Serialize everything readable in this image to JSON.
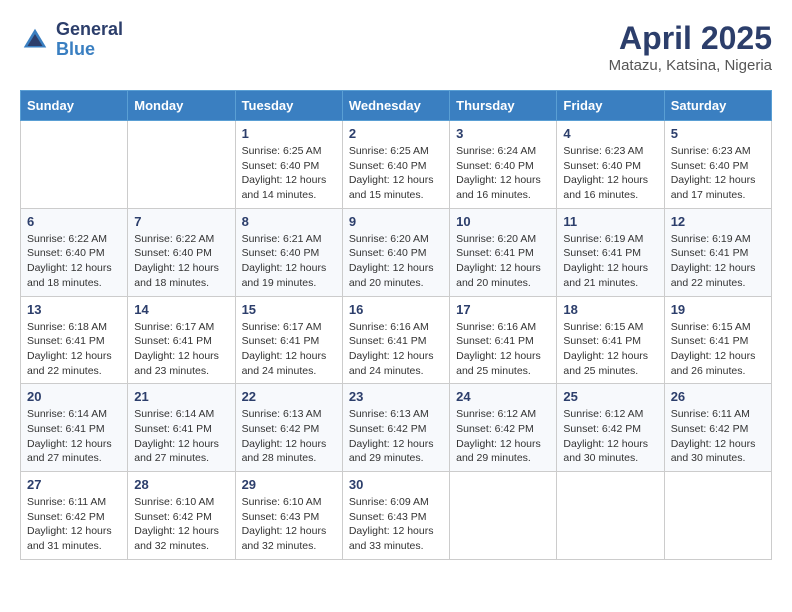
{
  "logo": {
    "general": "General",
    "blue": "Blue"
  },
  "title": "April 2025",
  "subtitle": "Matazu, Katsina, Nigeria",
  "days_of_week": [
    "Sunday",
    "Monday",
    "Tuesday",
    "Wednesday",
    "Thursday",
    "Friday",
    "Saturday"
  ],
  "weeks": [
    [
      {
        "day": "",
        "sunrise": "",
        "sunset": "",
        "daylight": ""
      },
      {
        "day": "",
        "sunrise": "",
        "sunset": "",
        "daylight": ""
      },
      {
        "day": "1",
        "sunrise": "Sunrise: 6:25 AM",
        "sunset": "Sunset: 6:40 PM",
        "daylight": "Daylight: 12 hours and 14 minutes."
      },
      {
        "day": "2",
        "sunrise": "Sunrise: 6:25 AM",
        "sunset": "Sunset: 6:40 PM",
        "daylight": "Daylight: 12 hours and 15 minutes."
      },
      {
        "day": "3",
        "sunrise": "Sunrise: 6:24 AM",
        "sunset": "Sunset: 6:40 PM",
        "daylight": "Daylight: 12 hours and 16 minutes."
      },
      {
        "day": "4",
        "sunrise": "Sunrise: 6:23 AM",
        "sunset": "Sunset: 6:40 PM",
        "daylight": "Daylight: 12 hours and 16 minutes."
      },
      {
        "day": "5",
        "sunrise": "Sunrise: 6:23 AM",
        "sunset": "Sunset: 6:40 PM",
        "daylight": "Daylight: 12 hours and 17 minutes."
      }
    ],
    [
      {
        "day": "6",
        "sunrise": "Sunrise: 6:22 AM",
        "sunset": "Sunset: 6:40 PM",
        "daylight": "Daylight: 12 hours and 18 minutes."
      },
      {
        "day": "7",
        "sunrise": "Sunrise: 6:22 AM",
        "sunset": "Sunset: 6:40 PM",
        "daylight": "Daylight: 12 hours and 18 minutes."
      },
      {
        "day": "8",
        "sunrise": "Sunrise: 6:21 AM",
        "sunset": "Sunset: 6:40 PM",
        "daylight": "Daylight: 12 hours and 19 minutes."
      },
      {
        "day": "9",
        "sunrise": "Sunrise: 6:20 AM",
        "sunset": "Sunset: 6:40 PM",
        "daylight": "Daylight: 12 hours and 20 minutes."
      },
      {
        "day": "10",
        "sunrise": "Sunrise: 6:20 AM",
        "sunset": "Sunset: 6:41 PM",
        "daylight": "Daylight: 12 hours and 20 minutes."
      },
      {
        "day": "11",
        "sunrise": "Sunrise: 6:19 AM",
        "sunset": "Sunset: 6:41 PM",
        "daylight": "Daylight: 12 hours and 21 minutes."
      },
      {
        "day": "12",
        "sunrise": "Sunrise: 6:19 AM",
        "sunset": "Sunset: 6:41 PM",
        "daylight": "Daylight: 12 hours and 22 minutes."
      }
    ],
    [
      {
        "day": "13",
        "sunrise": "Sunrise: 6:18 AM",
        "sunset": "Sunset: 6:41 PM",
        "daylight": "Daylight: 12 hours and 22 minutes."
      },
      {
        "day": "14",
        "sunrise": "Sunrise: 6:17 AM",
        "sunset": "Sunset: 6:41 PM",
        "daylight": "Daylight: 12 hours and 23 minutes."
      },
      {
        "day": "15",
        "sunrise": "Sunrise: 6:17 AM",
        "sunset": "Sunset: 6:41 PM",
        "daylight": "Daylight: 12 hours and 24 minutes."
      },
      {
        "day": "16",
        "sunrise": "Sunrise: 6:16 AM",
        "sunset": "Sunset: 6:41 PM",
        "daylight": "Daylight: 12 hours and 24 minutes."
      },
      {
        "day": "17",
        "sunrise": "Sunrise: 6:16 AM",
        "sunset": "Sunset: 6:41 PM",
        "daylight": "Daylight: 12 hours and 25 minutes."
      },
      {
        "day": "18",
        "sunrise": "Sunrise: 6:15 AM",
        "sunset": "Sunset: 6:41 PM",
        "daylight": "Daylight: 12 hours and 25 minutes."
      },
      {
        "day": "19",
        "sunrise": "Sunrise: 6:15 AM",
        "sunset": "Sunset: 6:41 PM",
        "daylight": "Daylight: 12 hours and 26 minutes."
      }
    ],
    [
      {
        "day": "20",
        "sunrise": "Sunrise: 6:14 AM",
        "sunset": "Sunset: 6:41 PM",
        "daylight": "Daylight: 12 hours and 27 minutes."
      },
      {
        "day": "21",
        "sunrise": "Sunrise: 6:14 AM",
        "sunset": "Sunset: 6:41 PM",
        "daylight": "Daylight: 12 hours and 27 minutes."
      },
      {
        "day": "22",
        "sunrise": "Sunrise: 6:13 AM",
        "sunset": "Sunset: 6:42 PM",
        "daylight": "Daylight: 12 hours and 28 minutes."
      },
      {
        "day": "23",
        "sunrise": "Sunrise: 6:13 AM",
        "sunset": "Sunset: 6:42 PM",
        "daylight": "Daylight: 12 hours and 29 minutes."
      },
      {
        "day": "24",
        "sunrise": "Sunrise: 6:12 AM",
        "sunset": "Sunset: 6:42 PM",
        "daylight": "Daylight: 12 hours and 29 minutes."
      },
      {
        "day": "25",
        "sunrise": "Sunrise: 6:12 AM",
        "sunset": "Sunset: 6:42 PM",
        "daylight": "Daylight: 12 hours and 30 minutes."
      },
      {
        "day": "26",
        "sunrise": "Sunrise: 6:11 AM",
        "sunset": "Sunset: 6:42 PM",
        "daylight": "Daylight: 12 hours and 30 minutes."
      }
    ],
    [
      {
        "day": "27",
        "sunrise": "Sunrise: 6:11 AM",
        "sunset": "Sunset: 6:42 PM",
        "daylight": "Daylight: 12 hours and 31 minutes."
      },
      {
        "day": "28",
        "sunrise": "Sunrise: 6:10 AM",
        "sunset": "Sunset: 6:42 PM",
        "daylight": "Daylight: 12 hours and 32 minutes."
      },
      {
        "day": "29",
        "sunrise": "Sunrise: 6:10 AM",
        "sunset": "Sunset: 6:43 PM",
        "daylight": "Daylight: 12 hours and 32 minutes."
      },
      {
        "day": "30",
        "sunrise": "Sunrise: 6:09 AM",
        "sunset": "Sunset: 6:43 PM",
        "daylight": "Daylight: 12 hours and 33 minutes."
      },
      {
        "day": "",
        "sunrise": "",
        "sunset": "",
        "daylight": ""
      },
      {
        "day": "",
        "sunrise": "",
        "sunset": "",
        "daylight": ""
      },
      {
        "day": "",
        "sunrise": "",
        "sunset": "",
        "daylight": ""
      }
    ]
  ]
}
